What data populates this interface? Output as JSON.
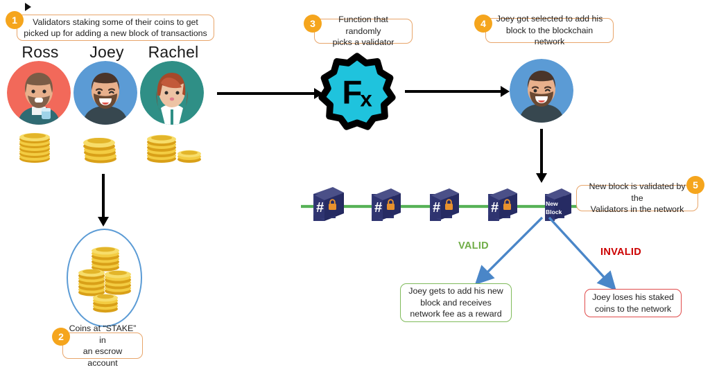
{
  "diagram": {
    "title": "Proof of Stake validation flow",
    "colors": {
      "badge": "#f5a51d",
      "callout_border": "#e8a56a",
      "valid_green": "#70ad47",
      "invalid_red": "#cc0000",
      "chain_line": "#57b257",
      "block_navy": "#2f3470",
      "lock_orange": "#e8912d",
      "fx_cyan": "#1fc3dd",
      "blue_arrow": "#4a86c8",
      "escrow_outline": "#5b9bd5"
    }
  },
  "callouts": [
    {
      "number": "1",
      "line1": "Validators staking some of their coins to get",
      "line2": "picked up for adding a new block of transactions"
    },
    {
      "number": "2",
      "line1": "Coins at “STAKE” in",
      "line2": "an escrow account"
    },
    {
      "number": "3",
      "line1": "Function that randomly",
      "line2": "picks a validator"
    },
    {
      "number": "4",
      "line1": "Joey got selected to add his",
      "line2": "block to the blockchain network"
    },
    {
      "number": "5",
      "line1": "New block is validated by the",
      "line2": "Validators in the network"
    }
  ],
  "validators": [
    {
      "name": "Ross",
      "avatar_bg": "#f2695a",
      "shirt": "#2f6b73",
      "hair": "#7a5c46"
    },
    {
      "name": "Joey",
      "avatar_bg": "#5b9bd5",
      "shirt": "#37474f",
      "hair": "#4a352a"
    },
    {
      "name": "Rachel",
      "avatar_bg": "#2f8f86",
      "shirt": "#ffffff",
      "hair": "#a5492a"
    }
  ],
  "function_node": {
    "label": "Fx",
    "shape": "starburst-badge"
  },
  "selected_validator": {
    "name": "Joey",
    "avatar_bg": "#5b9bd5"
  },
  "blockchain": {
    "blocks": [
      {
        "glyph": "#",
        "has_lock": true,
        "label": ""
      },
      {
        "glyph": "#",
        "has_lock": true,
        "label": ""
      },
      {
        "glyph": "#",
        "has_lock": true,
        "label": ""
      },
      {
        "glyph": "#",
        "has_lock": true,
        "label": ""
      }
    ],
    "new_block": {
      "line1": "New",
      "line2": "Block"
    }
  },
  "outcomes": [
    {
      "verdict": "VALID",
      "line1": "Joey gets to add his new",
      "line2": "block and receives",
      "line3": "network fee as a reward"
    },
    {
      "verdict": "INVALID",
      "line1": "Joey loses his staked",
      "line2": "coins to the network",
      "line3": ""
    }
  ]
}
